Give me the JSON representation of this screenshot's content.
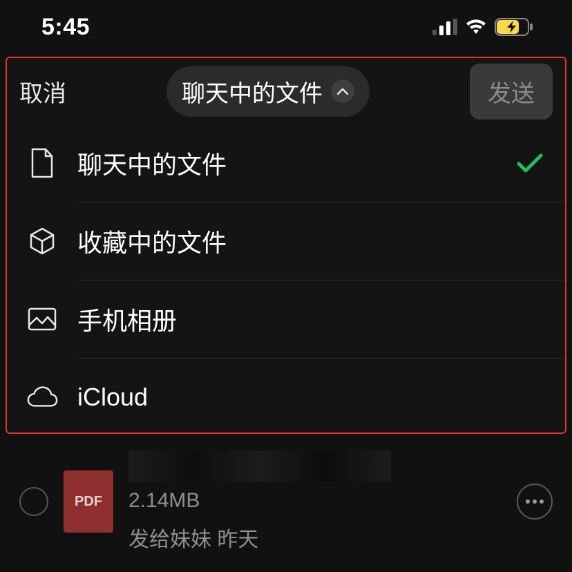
{
  "status": {
    "time": "5:45"
  },
  "header": {
    "cancel": "取消",
    "title": "聊天中的文件",
    "send": "发送"
  },
  "menu": [
    {
      "icon": "file-icon",
      "label": "聊天中的文件",
      "selected": true
    },
    {
      "icon": "box-icon",
      "label": "收藏中的文件",
      "selected": false
    },
    {
      "icon": "photo-icon",
      "label": "手机相册",
      "selected": false
    },
    {
      "icon": "cloud-icon",
      "label": "iCloud",
      "selected": false
    }
  ],
  "file": {
    "type": "PDF",
    "size": "2.14MB",
    "sent_prefix": "发给妹妹",
    "sent_when": "昨天"
  }
}
